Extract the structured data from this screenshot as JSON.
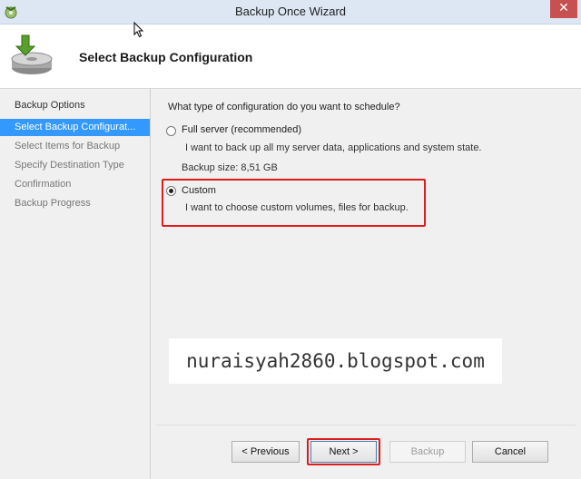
{
  "window": {
    "title": "Backup Once Wizard",
    "close_label": "✕"
  },
  "header": {
    "title": "Select Backup Configuration"
  },
  "sidebar": {
    "steps": [
      {
        "label": "Backup Options"
      },
      {
        "label": "Select Backup Configurat..."
      },
      {
        "label": "Select Items for Backup"
      },
      {
        "label": "Specify Destination Type"
      },
      {
        "label": "Confirmation"
      },
      {
        "label": "Backup Progress"
      }
    ],
    "active_index": 1
  },
  "main": {
    "question": "What type of configuration do you want to schedule?",
    "options": [
      {
        "label": "Full server (recommended)",
        "description": "I want to back up all my server data, applications and system state.",
        "detail": "Backup size: 8,51 GB",
        "selected": false
      },
      {
        "label": "Custom",
        "description": "I want to choose custom volumes, files for backup.",
        "selected": true
      }
    ]
  },
  "watermark": "nuraisyah2860.blogspot.com",
  "buttons": {
    "previous": "< Previous",
    "next": "Next >",
    "backup": "Backup",
    "cancel": "Cancel"
  },
  "colors": {
    "active_step": "#3399ff",
    "highlight": "#e01b1b",
    "close_button": "#c75050"
  }
}
